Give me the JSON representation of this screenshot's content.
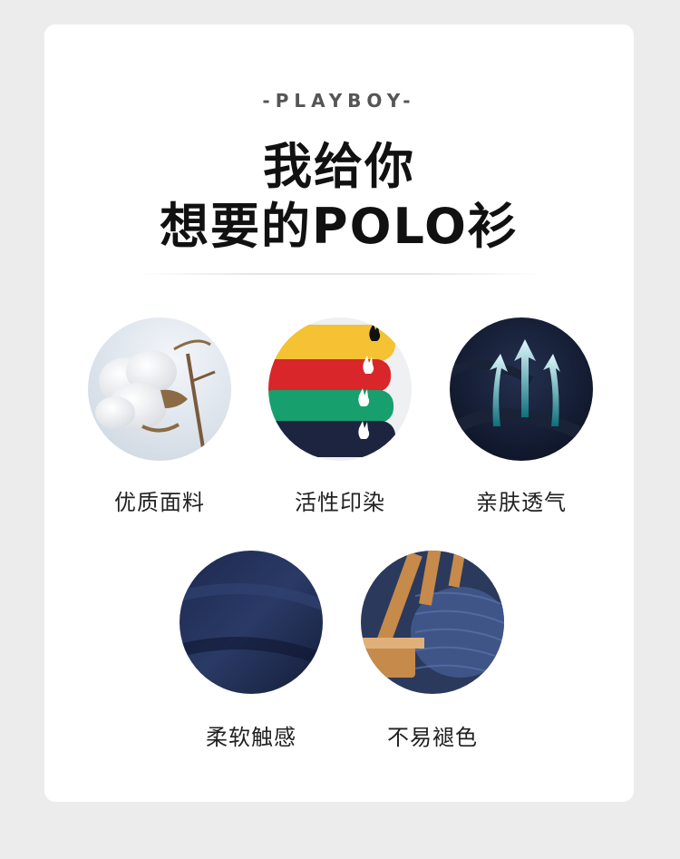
{
  "brand": "-PLAYBOY-",
  "title": {
    "line1": "我给你",
    "line2": "想要的POLO衫"
  },
  "features": [
    {
      "label": "优质面料",
      "icon": "cotton-icon"
    },
    {
      "label": "活性印染",
      "icon": "dyed-shirts-icon"
    },
    {
      "label": "亲肤透气",
      "icon": "breathable-arrows-icon"
    },
    {
      "label": "柔软触感",
      "icon": "soft-fabric-icon"
    },
    {
      "label": "不易褪色",
      "icon": "yarn-spools-icon"
    }
  ]
}
